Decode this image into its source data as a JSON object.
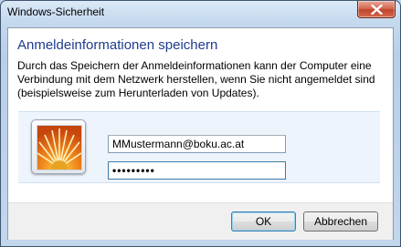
{
  "window": {
    "title": "Windows-Sicherheit",
    "close_icon": "close-icon"
  },
  "dialog": {
    "heading": "Anmeldeinformationen speichern",
    "description_lines": [
      "Durch das Speichern der Anmeldeinformationen kann der Computer eine",
      "Verbindung mit dem Netzwerk herstellen, wenn Sie nicht angemeldet sind",
      "(beispielsweise zum Herunterladen von Updates)."
    ]
  },
  "credentials": {
    "user_tile_icon": "user-tile-flower-icon",
    "username_value": "MMustermann@boku.ac.at",
    "password_value": "•••••••••"
  },
  "buttons": {
    "ok_label": "OK",
    "cancel_label": "Abbrechen"
  },
  "colors": {
    "heading": "#1e3b8e",
    "close_button": "#c0432a",
    "title_bar": "#c5d9ee"
  }
}
